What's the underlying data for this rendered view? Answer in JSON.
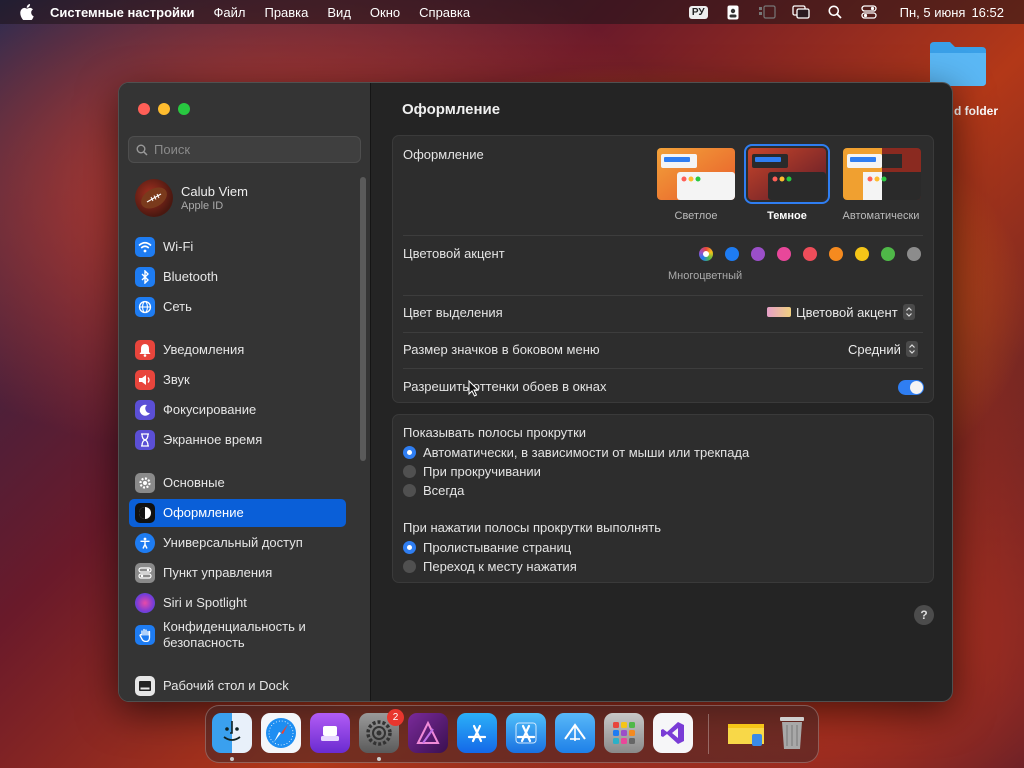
{
  "menubar": {
    "app_name": "Системные настройки",
    "items": [
      "Файл",
      "Правка",
      "Вид",
      "Окно",
      "Справка"
    ],
    "lang": "РУ",
    "date": "Пн, 5 июня",
    "time": "16:52"
  },
  "desktop": {
    "folder_label": "d folder"
  },
  "sidebar": {
    "search_placeholder": "Поиск",
    "account": {
      "name": "Calub Viem",
      "subtitle": "Apple ID"
    },
    "items": [
      {
        "label": "Wi-Fi",
        "icon": "wifi-icon",
        "color": "#1e7cf2"
      },
      {
        "label": "Bluetooth",
        "icon": "bluetooth-icon",
        "color": "#1e7cf2"
      },
      {
        "label": "Сеть",
        "icon": "globe-icon",
        "color": "#1e7cf2"
      },
      {
        "label": "Уведомления",
        "icon": "bell-icon",
        "color": "#e8453c"
      },
      {
        "label": "Звук",
        "icon": "speaker-icon",
        "color": "#e8453c"
      },
      {
        "label": "Фокусирование",
        "icon": "moon-icon",
        "color": "#5b4fd6"
      },
      {
        "label": "Экранное время",
        "icon": "hourglass-icon",
        "color": "#5b4fd6"
      },
      {
        "label": "Основные",
        "icon": "gear-icon",
        "color": "#8a8a8a"
      },
      {
        "label": "Оформление",
        "icon": "appearance-icon",
        "color": "#111111"
      },
      {
        "label": "Универсальный доступ",
        "icon": "accessibility-icon",
        "color": "#1e7cf2"
      },
      {
        "label": "Пункт управления",
        "icon": "control-center-icon",
        "color": "#8a8a8a"
      },
      {
        "label": "Siri и Spotlight",
        "icon": "siri-icon",
        "color": "#7a3cd6"
      },
      {
        "label": "Конфиденциальность и безопасность",
        "icon": "hand-icon",
        "color": "#1e7cf2"
      },
      {
        "label": "Рабочий стол и Dock",
        "icon": "dock-icon",
        "color": "#222222"
      }
    ]
  },
  "content": {
    "title": "Оформление",
    "appearance": {
      "label": "Оформление",
      "options": [
        "Светлое",
        "Темное",
        "Автоматически"
      ],
      "selected": "Темное"
    },
    "accent": {
      "label": "Цветовой акцент",
      "caption": "Многоцветный",
      "colors": [
        "#1e7cf2",
        "#9b4fc8",
        "#e8479a",
        "#ee4d5a",
        "#f58a1f",
        "#f5c518",
        "#4fb848",
        "#8c8c8c"
      ]
    },
    "highlight": {
      "label": "Цвет выделения",
      "value": "Цветовой акцент"
    },
    "icon_size": {
      "label": "Размер значков в боковом меню",
      "value": "Средний"
    },
    "tinting": {
      "label": "Разрешить оттенки обоев в окнах",
      "enabled": true
    },
    "scrollbars": {
      "label": "Показывать полосы прокрутки",
      "options": [
        "Автоматически, в зависимости от мыши или трекпада",
        "При прокручивании",
        "Всегда"
      ],
      "selected": 0
    },
    "scroll_click": {
      "label": "При нажатии полосы прокрутки выполнять",
      "options": [
        "Пролистывание страниц",
        "Переход к месту нажатия"
      ],
      "selected": 0
    },
    "help": "?"
  },
  "dock": {
    "settings_badge": "2",
    "apps": [
      "finder-icon",
      "safari-icon",
      "podcasts-icon",
      "settings-icon",
      "affinity-icon",
      "app-store-icon",
      "xcode-icon",
      "testflight-icon",
      "launchpad-icon",
      "visual-studio-icon",
      "folder-icon",
      "trash-icon"
    ]
  }
}
